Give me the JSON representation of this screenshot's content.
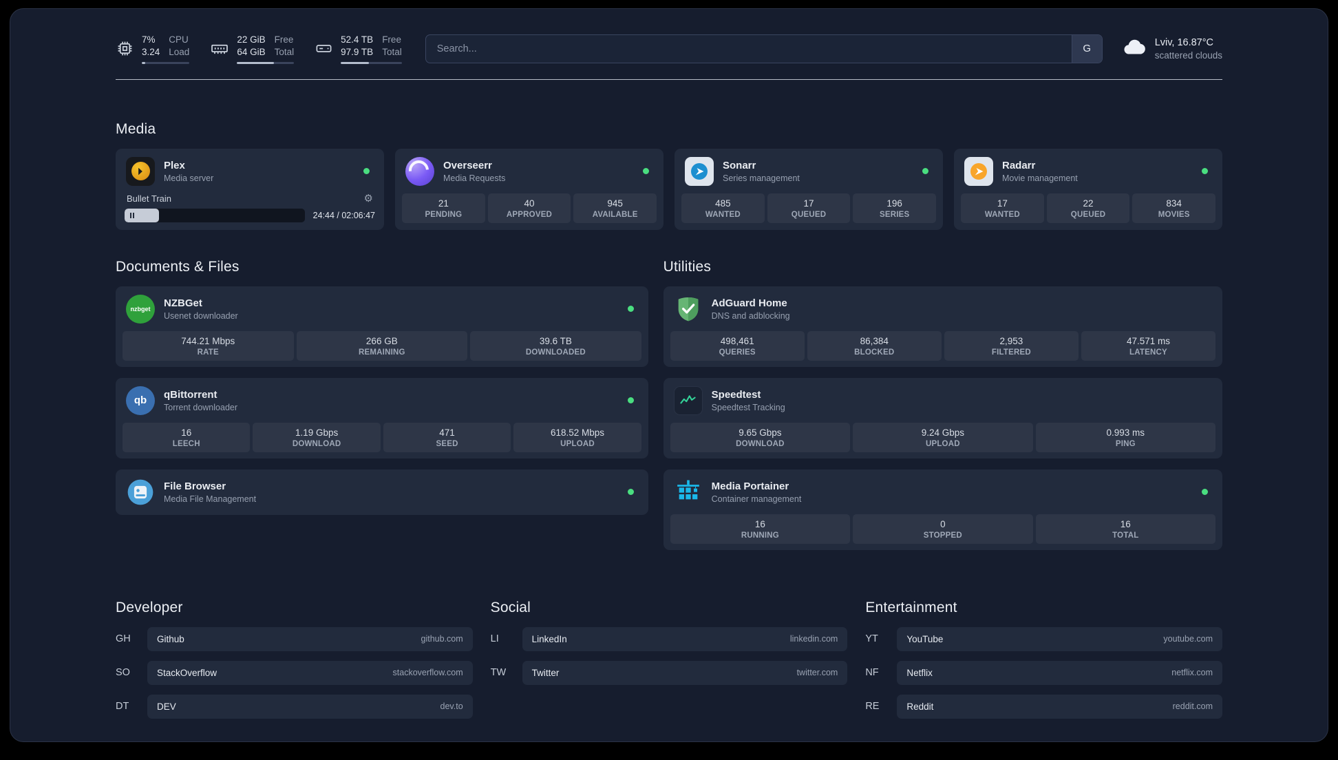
{
  "colors": {
    "status_online": "#4ade80"
  },
  "icons": {
    "gear_glyph": "⚙"
  },
  "topbar": {
    "cpu": {
      "icon": "cpu-icon",
      "value_top": "7%",
      "value_bottom": "3.24",
      "label_top": "CPU",
      "label_bottom": "Load",
      "progress": 7
    },
    "memory": {
      "icon": "memory-icon",
      "value_top": "22 GiB",
      "value_bottom": "64 GiB",
      "label_top": "Free",
      "label_bottom": "Total",
      "progress": 65
    },
    "disk": {
      "icon": "disk-icon",
      "value_top": "52.4 TB",
      "value_bottom": "97.9 TB",
      "label_top": "Free",
      "label_bottom": "Total",
      "progress": 46
    },
    "search": {
      "placeholder": "Search...",
      "button_label": "G"
    },
    "weather": {
      "icon": "cloud-icon",
      "location": "Lviv, 16.87°C",
      "condition": "scattered clouds"
    }
  },
  "media": {
    "title": "Media",
    "cards": [
      {
        "id": "plex",
        "name": "Plex",
        "description": "Media server",
        "icon": "plex-icon",
        "online": true,
        "player": {
          "title": "Bullet Train",
          "time": "24:44 / 02:06:47",
          "progress": 19
        },
        "stats": []
      },
      {
        "id": "overseerr",
        "name": "Overseerr",
        "description": "Media Requests",
        "icon": "overseerr-icon",
        "online": true,
        "stats": [
          {
            "value": "21",
            "label": "PENDING"
          },
          {
            "value": "40",
            "label": "APPROVED"
          },
          {
            "value": "945",
            "label": "AVAILABLE"
          }
        ]
      },
      {
        "id": "sonarr",
        "name": "Sonarr",
        "description": "Series management",
        "icon": "sonarr-icon",
        "online": true,
        "stats": [
          {
            "value": "485",
            "label": "WANTED"
          },
          {
            "value": "17",
            "label": "QUEUED"
          },
          {
            "value": "196",
            "label": "SERIES"
          }
        ]
      },
      {
        "id": "radarr",
        "name": "Radarr",
        "description": "Movie management",
        "icon": "radarr-icon",
        "online": true,
        "stats": [
          {
            "value": "17",
            "label": "WANTED"
          },
          {
            "value": "22",
            "label": "QUEUED"
          },
          {
            "value": "834",
            "label": "MOVIES"
          }
        ]
      }
    ]
  },
  "documents": {
    "title": "Documents & Files",
    "cards": [
      {
        "id": "nzbget",
        "name": "NZBGet",
        "description": "Usenet downloader",
        "icon": "nzbget-icon",
        "online": true,
        "stats": [
          {
            "value": "744.21 Mbps",
            "label": "RATE"
          },
          {
            "value": "266 GB",
            "label": "REMAINING"
          },
          {
            "value": "39.6 TB",
            "label": "DOWNLOADED"
          }
        ]
      },
      {
        "id": "qbittorrent",
        "name": "qBittorrent",
        "description": "Torrent downloader",
        "icon": "qbittorrent-icon",
        "online": true,
        "stats": [
          {
            "value": "16",
            "label": "LEECH"
          },
          {
            "value": "1.19 Gbps",
            "label": "DOWNLOAD"
          },
          {
            "value": "471",
            "label": "SEED"
          },
          {
            "value": "618.52 Mbps",
            "label": "UPLOAD"
          }
        ]
      },
      {
        "id": "filebrowser",
        "name": "File Browser",
        "description": "Media File Management",
        "icon": "filebrowser-icon",
        "online": true,
        "stats": []
      }
    ]
  },
  "utilities": {
    "title": "Utilities",
    "cards": [
      {
        "id": "adguard",
        "name": "AdGuard Home",
        "description": "DNS and adblocking",
        "icon": "adguard-icon",
        "online": false,
        "stats": [
          {
            "value": "498,461",
            "label": "QUERIES"
          },
          {
            "value": "86,384",
            "label": "BLOCKED"
          },
          {
            "value": "2,953",
            "label": "FILTERED"
          },
          {
            "value": "47.571 ms",
            "label": "LATENCY"
          }
        ]
      },
      {
        "id": "speedtest",
        "name": "Speedtest",
        "description": "Speedtest Tracking",
        "icon": "speedtest-icon",
        "online": false,
        "stats": [
          {
            "value": "9.65 Gbps",
            "label": "DOWNLOAD"
          },
          {
            "value": "9.24 Gbps",
            "label": "UPLOAD"
          },
          {
            "value": "0.993 ms",
            "label": "PING"
          }
        ]
      },
      {
        "id": "portainer",
        "name": "Media Portainer",
        "description": "Container management",
        "icon": "portainer-icon",
        "online": true,
        "stats": [
          {
            "value": "16",
            "label": "RUNNING"
          },
          {
            "value": "0",
            "label": "STOPPED"
          },
          {
            "value": "16",
            "label": "TOTAL"
          }
        ]
      }
    ]
  },
  "bookmarks": {
    "groups": [
      {
        "title": "Developer",
        "links": [
          {
            "abbr": "GH",
            "name": "Github",
            "url": "github.com"
          },
          {
            "abbr": "SO",
            "name": "StackOverflow",
            "url": "stackoverflow.com"
          },
          {
            "abbr": "DT",
            "name": "DEV",
            "url": "dev.to"
          }
        ]
      },
      {
        "title": "Social",
        "links": [
          {
            "abbr": "LI",
            "name": "LinkedIn",
            "url": "linkedin.com"
          },
          {
            "abbr": "TW",
            "name": "Twitter",
            "url": "twitter.com"
          }
        ]
      },
      {
        "title": "Entertainment",
        "links": [
          {
            "abbr": "YT",
            "name": "YouTube",
            "url": "youtube.com"
          },
          {
            "abbr": "NF",
            "name": "Netflix",
            "url": "netflix.com"
          },
          {
            "abbr": "RE",
            "name": "Reddit",
            "url": "reddit.com"
          }
        ]
      }
    ]
  }
}
